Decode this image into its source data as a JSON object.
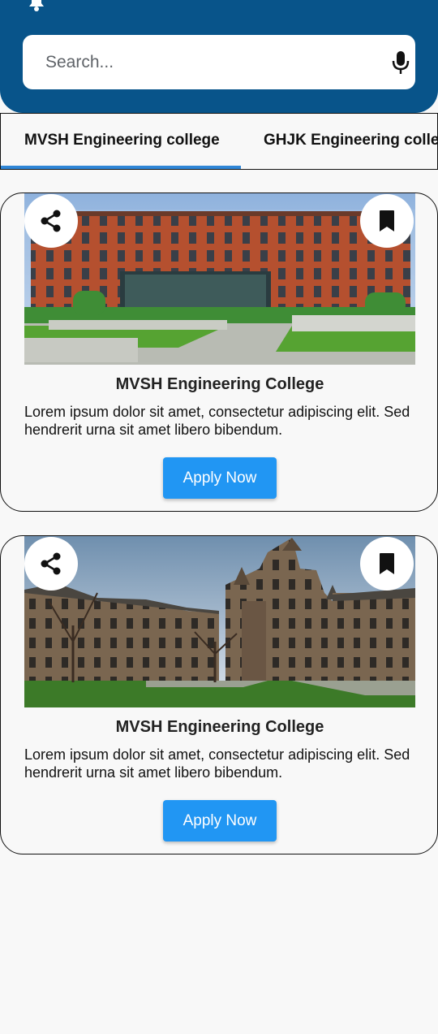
{
  "search": {
    "placeholder": "Search..."
  },
  "tabs": [
    {
      "label": "MVSH Engineering college"
    },
    {
      "label": "GHJK Engineering college"
    }
  ],
  "cards": [
    {
      "title": "MVSH Engineering College",
      "description": "Lorem ipsum dolor sit amet, consectetur adipiscing elit. Sed hendrerit urna sit amet libero bibendum.",
      "button": "Apply Now"
    },
    {
      "title": "MVSH Engineering College",
      "description": "Lorem ipsum dolor sit amet, consectetur adipiscing elit. Sed hendrerit urna sit amet libero bibendum.",
      "button": "Apply Now"
    }
  ],
  "icons": {
    "header": "bell-icon",
    "search": "microphone-icon",
    "card_left": "share-icon",
    "card_right": "bookmark-icon"
  },
  "colors": {
    "header": "#08548a",
    "accent": "#2196f3",
    "tab_indicator": "#2f86d6"
  }
}
